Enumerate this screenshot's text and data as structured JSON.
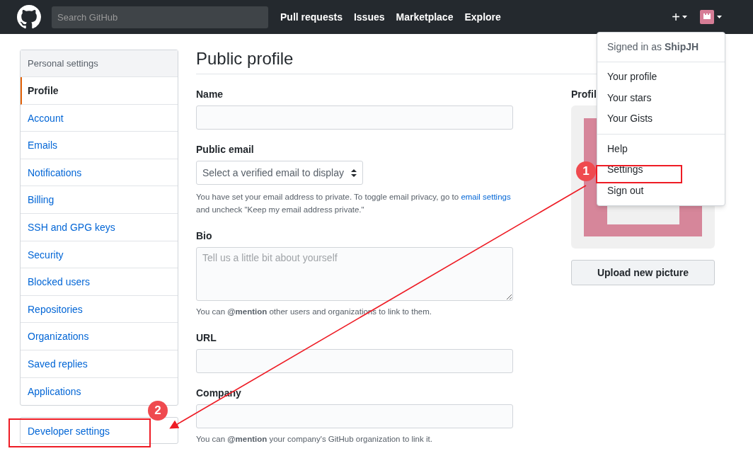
{
  "header": {
    "search": {
      "placeholder": "Search GitHub"
    },
    "nav": [
      "Pull requests",
      "Issues",
      "Marketplace",
      "Explore"
    ],
    "plus": "+"
  },
  "sidebar": {
    "title": "Personal settings",
    "items": [
      {
        "label": "Profile",
        "selected": true
      },
      {
        "label": "Account",
        "selected": false
      },
      {
        "label": "Emails",
        "selected": false
      },
      {
        "label": "Notifications",
        "selected": false
      },
      {
        "label": "Billing",
        "selected": false
      },
      {
        "label": "SSH and GPG keys",
        "selected": false
      },
      {
        "label": "Security",
        "selected": false
      },
      {
        "label": "Blocked users",
        "selected": false
      },
      {
        "label": "Repositories",
        "selected": false
      },
      {
        "label": "Organizations",
        "selected": false
      },
      {
        "label": "Saved replies",
        "selected": false
      },
      {
        "label": "Applications",
        "selected": false
      }
    ],
    "developer_link": "Developer settings"
  },
  "main": {
    "title": "Public profile",
    "fields": [
      {
        "kind": "input",
        "label": "Name"
      },
      {
        "kind": "select",
        "label": "Public email",
        "placeholder": "Select a verified email to display",
        "note": "You have set your email address to private. To toggle email privacy, go to ",
        "link": "email settings",
        "note_end": "and uncheck \"Keep my email address private.\""
      },
      {
        "kind": "textarea",
        "label": "Bio",
        "placeholder": "Tell us a little bit about yourself",
        "note": "You can **@mention** other users and organizations to link to them."
      },
      {
        "kind": "input",
        "label": "URL"
      },
      {
        "kind": "input",
        "label": "Company",
        "note": "You can **@mention** your company's GitHub organization to link it."
      }
    ]
  },
  "picture": {
    "label": "Profil",
    "button": "Upload new picture"
  },
  "user_menu": {
    "signed_in": "Signed in as **ShipJH**",
    "groups": [
      [
        "Your profile",
        "Your stars",
        "Your Gists"
      ],
      [
        "Help",
        "Settings",
        "Sign out"
      ]
    ]
  },
  "annotations": [
    {
      "number": "1"
    },
    {
      "number": "2"
    }
  ]
}
